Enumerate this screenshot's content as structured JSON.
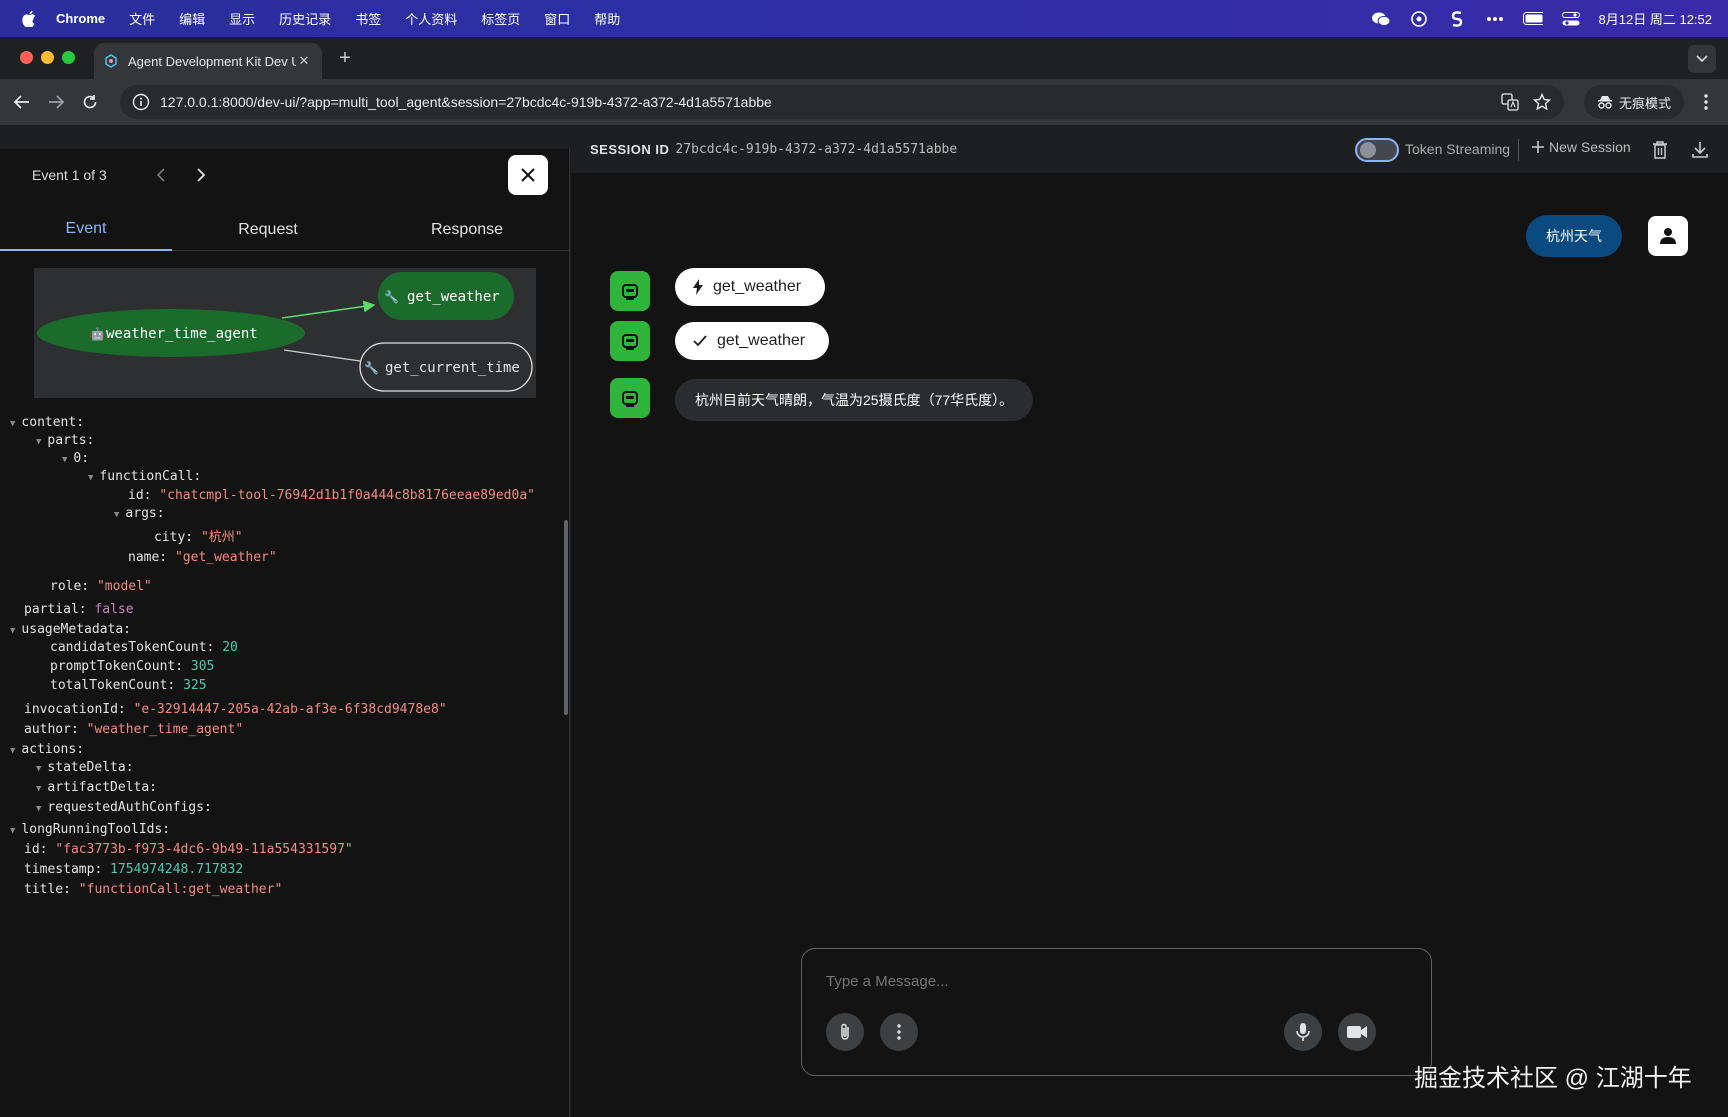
{
  "menubar": {
    "app": "Chrome",
    "items": [
      "文件",
      "编辑",
      "显示",
      "历史记录",
      "书签",
      "个人资料",
      "标签页",
      "窗口",
      "帮助"
    ],
    "datetime": "8月12日 周二 12:52"
  },
  "browser": {
    "tab_title": "Agent Development Kit Dev U",
    "url": "127.0.0.1:8000/dev-ui/?app=multi_tool_agent&session=27bcdc4c-919b-4372-a372-4d1a5571abbe",
    "incognito_label": "无痕模式"
  },
  "event_panel": {
    "event_counter": "Event 1 of 3",
    "tabs": [
      "Event",
      "Request",
      "Response"
    ],
    "active_tab": "Event",
    "graph": {
      "agent_node": "weather_time_agent",
      "tool_nodes": [
        "get_weather",
        "get_current_time"
      ]
    },
    "json": {
      "content_key": "content:",
      "parts_key": "parts:",
      "index_key": "0:",
      "functionCall_key": "functionCall:",
      "id_key": "id:",
      "id_val": "\"chatcmpl-tool-76942d1b1f0a444c8b8176eeae89ed0a\"",
      "args_key": "args:",
      "city_key": "city:",
      "city_val": "\"杭州\"",
      "name_key": "name:",
      "name_val": "\"get_weather\"",
      "role_key": "role:",
      "role_val": "\"model\"",
      "partial_key": "partial:",
      "partial_val": "false",
      "usage_key": "usageMetadata:",
      "cand_key": "candidatesTokenCount:",
      "cand_val": "20",
      "prompt_key": "promptTokenCount:",
      "prompt_val": "305",
      "total_key": "totalTokenCount:",
      "total_val": "325",
      "inv_key": "invocationId:",
      "inv_val": "\"e-32914447-205a-42ab-af3e-6f38cd9478e8\"",
      "author_key": "author:",
      "author_val": "\"weather_time_agent\"",
      "actions_key": "actions:",
      "state_key": "stateDelta:",
      "artifact_key": "artifactDelta:",
      "reqauth_key": "requestedAuthConfigs:",
      "lrt_key": "longRunningToolIds:",
      "eid_key": "id:",
      "eid_val": "\"fac3773b-f973-4dc6-9b49-11a554331597\"",
      "ts_key": "timestamp:",
      "ts_val": "1754974248.717832",
      "title_key": "title:",
      "title_val": "\"functionCall:get_weather\""
    }
  },
  "chat": {
    "session_label": "SESSION ID",
    "session_id": "27bcdc4c-919b-4372-a372-4d1a5571abbe",
    "token_streaming_label": "Token Streaming",
    "new_session_label": "New Session",
    "user_message": "杭州天气",
    "function_call_chip": "get_weather",
    "function_response_chip": "get_weather",
    "agent_reply": "杭州目前天气晴朗，气温为25摄氏度（77华氏度）。",
    "input_placeholder": "Type a Message..."
  },
  "watermark": "掘金技术社区 @ 江湖十年",
  "colors": {
    "accent": "#8ab4f8",
    "agent_green": "#30b53c",
    "graph_node": "#1b6b2c",
    "user_bubble": "#0b4a7e",
    "string": "#f28b82",
    "number": "#4ec9b0"
  }
}
